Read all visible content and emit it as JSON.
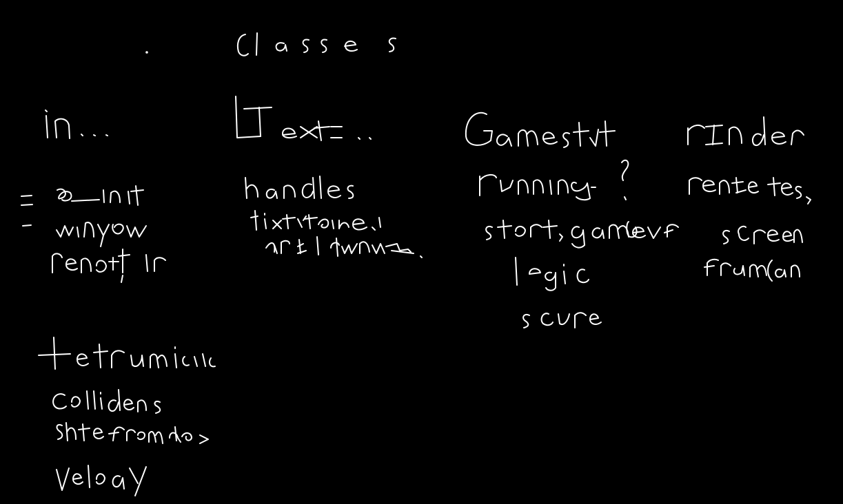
{
  "canvas": {
    "background": "#000000",
    "ink_color": "#ffffff",
    "style": "handwritten whiteboard sketch"
  },
  "notes": {
    "heading": "classes",
    "columns": [
      {
        "title": "in...",
        "items": [
          "- sdl_init",
          "- window",
          "renderer"
        ]
      },
      {
        "title": "LText",
        "items": [
          "handles",
          "text texture",
          "and dimensions"
        ]
      },
      {
        "title": "Gamestate",
        "items": [
          "running?",
          "start, game over",
          "logic",
          "score"
        ]
      },
      {
        "title": "render",
        "items": [
          "render text,",
          "screen",
          "frame(s)"
        ]
      }
    ],
    "extra": {
      "title": "+ entities",
      "items": [
        "collisions",
        "state from class",
        "velocity"
      ]
    }
  }
}
